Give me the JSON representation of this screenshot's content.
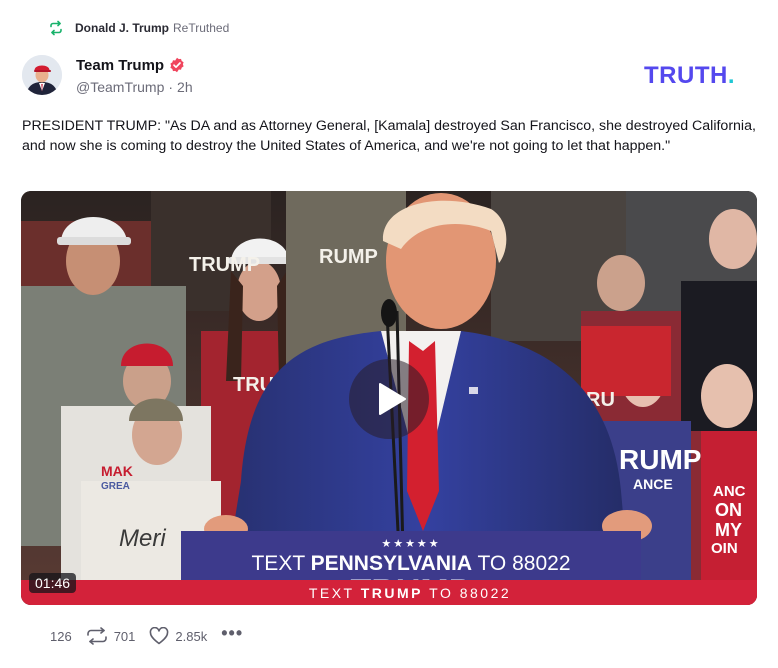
{
  "retruth": {
    "user": "Donald J. Trump",
    "label": "ReTruthed",
    "icon": "retruth-icon"
  },
  "author": {
    "name": "Team Trump",
    "handle": "@TeamTrump",
    "separator": "·",
    "time_ago": "2h",
    "verified_icon": "verified-badge-icon"
  },
  "brand": {
    "name": "TRUTH",
    "dot": ".",
    "color": "#5448ee",
    "dot_color": "#1fc7d4"
  },
  "post": {
    "text": "PRESIDENT TRUMP: \"As DA and as Attorney General, [Kamala] destroyed San Francisco, she destroyed California, and now she is coming to destroy the United States of America, and we're not going to let that happen.\""
  },
  "video": {
    "duration": "01:46",
    "play_icon": "play-icon",
    "podium_stars": "★★★★★",
    "podium_line1_prefix": "TEXT ",
    "podium_line1_state": "PENNSYLVANIA",
    "podium_line1_suffix": " TO 88022",
    "podium_line2_prefix": "TEXT ",
    "podium_line2_bold": "TRUMP",
    "podium_line2_suffix": " TO 88022",
    "podium_under": "TRUMP",
    "crowd_signs": [
      "TRUMP",
      "RUMP",
      "TRUMP",
      "RUMP",
      "TRU",
      "RUMP",
      "ANCE",
      "ANCE",
      "ON",
      "MY",
      "OIN",
      "RU",
      "Meri",
      "MAK",
      "GREA"
    ]
  },
  "actions": {
    "replies": "126",
    "retruths": "701",
    "likes": "2.85k",
    "more": "•••"
  },
  "colors": {
    "accent_green": "#18b26b",
    "verified_red": "#f0455d",
    "podium_blue": "#3d3a8c",
    "banner_red": "#d3223a"
  }
}
